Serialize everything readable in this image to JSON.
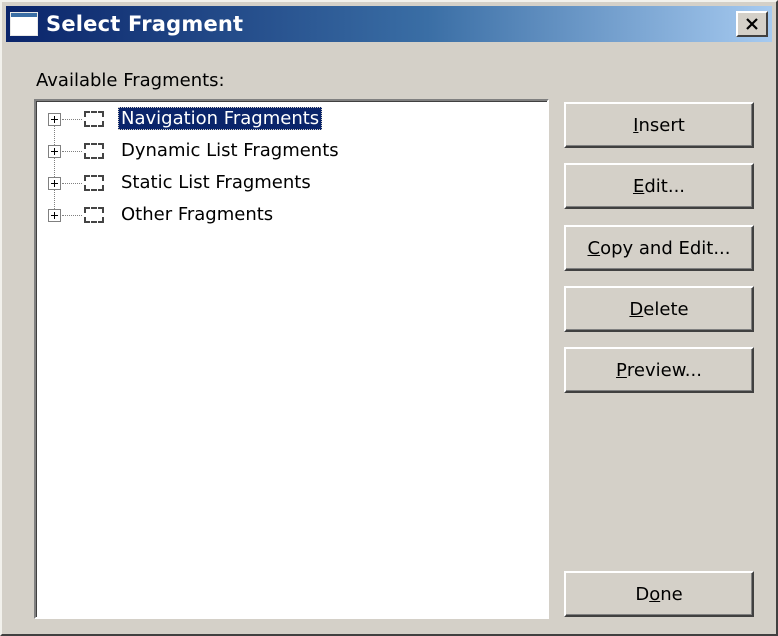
{
  "window": {
    "title": "Select Fragment"
  },
  "label": "Available Fragments:",
  "tree": {
    "items": [
      {
        "label": "Navigation Fragments",
        "selected": true
      },
      {
        "label": "Dynamic List Fragments",
        "selected": false
      },
      {
        "label": "Static List Fragments",
        "selected": false
      },
      {
        "label": "Other Fragments",
        "selected": false
      }
    ]
  },
  "buttons": {
    "insert": {
      "pre": "",
      "key": "I",
      "post": "nsert"
    },
    "edit": {
      "pre": "",
      "key": "E",
      "post": "dit..."
    },
    "copy_edit": {
      "pre": "",
      "key": "C",
      "post": "opy and Edit..."
    },
    "delete": {
      "pre": "",
      "key": "D",
      "post": "elete"
    },
    "preview": {
      "pre": "",
      "key": "P",
      "post": "review..."
    },
    "done": {
      "pre": "D",
      "key": "o",
      "post": "ne"
    }
  },
  "icons": {
    "title": "window-icon",
    "close": "close-icon",
    "expand": "plus-expander-icon",
    "fragment": "fragment-icon"
  }
}
